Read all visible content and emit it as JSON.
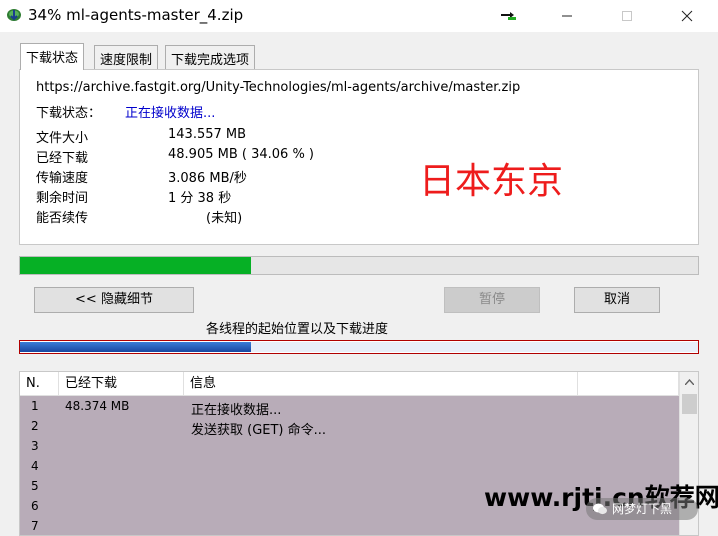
{
  "window": {
    "title": "34% ml-agents-master_4.zip"
  },
  "tabs": [
    {
      "label": "下载状态"
    },
    {
      "label": "速度限制"
    },
    {
      "label": "下载完成选项"
    }
  ],
  "status": {
    "url": "https://archive.fastgit.org/Unity-Technologies/ml-agents/archive/master.zip",
    "state_label": "下载状态：",
    "state_value": "正在接收数据...",
    "file_size_label": "文件大小",
    "file_size_value": "143.557  MB",
    "downloaded_label": "已经下载",
    "downloaded_value": "48.905  MB  ( 34.06 % )",
    "speed_label": "传输速度",
    "speed_value": "3.086  MB/秒",
    "remaining_label": "剩余时间",
    "remaining_value": "1 分 38 秒",
    "resume_label": "能否续传",
    "resume_value": "(未知)",
    "overlay_text": "日本东京"
  },
  "progress": {
    "percent": 34.06
  },
  "buttons": {
    "hide_details": "<< 隐藏细节",
    "pause": "暂停",
    "cancel": "取消"
  },
  "threads": {
    "caption": "各线程的起始位置以及下载进度",
    "progress_fraction": 0.34
  },
  "thread_list": {
    "headers": [
      "N.",
      "已经下载",
      "信息"
    ],
    "rows": [
      {
        "no": "1",
        "downloaded": "48.374  MB",
        "info": "正在接收数据..."
      },
      {
        "no": "2",
        "downloaded": "",
        "info": "发送获取 (GET) 命令..."
      },
      {
        "no": "3",
        "downloaded": "",
        "info": ""
      },
      {
        "no": "4",
        "downloaded": "",
        "info": ""
      },
      {
        "no": "5",
        "downloaded": "",
        "info": ""
      },
      {
        "no": "6",
        "downloaded": "",
        "info": ""
      },
      {
        "no": "7",
        "downloaded": "",
        "info": ""
      }
    ]
  },
  "watermark": {
    "site": "www.rjtj.cn软荐网",
    "badge": "网梦灯下黑"
  },
  "colors": {
    "progress_fill": "#06b025",
    "status_blue": "#0000cc",
    "overlay_red": "#ee1c1c",
    "list_background": "#b8acb8"
  }
}
